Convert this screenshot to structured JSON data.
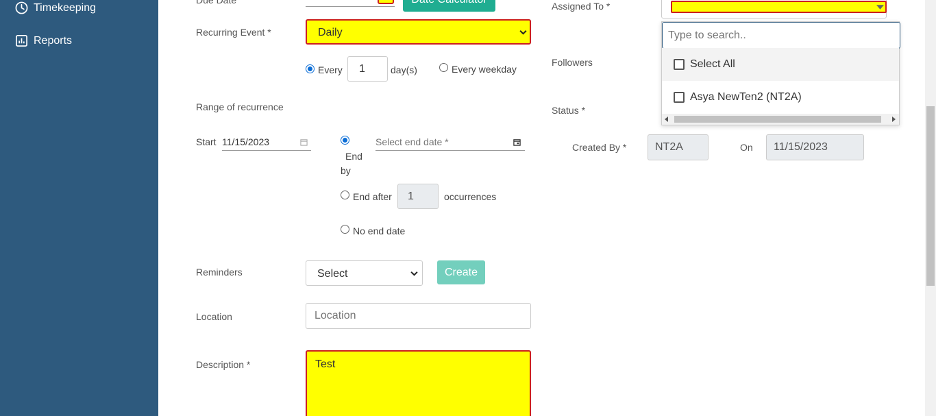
{
  "sidebar": {
    "items": [
      {
        "label": "Timekeeping",
        "icon": "clock-icon"
      },
      {
        "label": "Reports",
        "icon": "chart-icon"
      }
    ]
  },
  "form": {
    "due_date_label": "Due Date",
    "date_calculator_button": "Date Calculator",
    "recurring_event_label": "Recurring Event *",
    "recurring_event_value": "Daily",
    "every_label": "Every",
    "every_value": "1",
    "days_label": "day(s)",
    "every_weekday_label": "Every weekday",
    "range_label": "Range of recurrence",
    "start_label": "Start",
    "start_value": "11/15/2023",
    "end_date_placeholder": "Select end date *",
    "end_by_label": "End",
    "end_by_label2": "by",
    "end_after_label": "End after",
    "end_after_value": "1",
    "occurrences_label": "occurrences",
    "no_end_date_label": "No end date",
    "reminders_label": "Reminders",
    "reminders_value": "Select",
    "create_button": "Create",
    "location_label": "Location",
    "location_placeholder": "Location",
    "description_label": "Description *",
    "description_value": "Test"
  },
  "right": {
    "assigned_to_label": "Assigned To *",
    "followers_label": "Followers",
    "status_label": "Status *",
    "created_by_label": "Created By *",
    "created_by_value": "NT2A",
    "on_label": "On",
    "on_value": "11/15/2023"
  },
  "dropdown": {
    "search_placeholder": "Type to search..",
    "items": [
      {
        "label": "Select All",
        "checked": false
      },
      {
        "label": "Asya NewTen2 (NT2A)",
        "checked": false
      }
    ]
  },
  "colors": {
    "sidebar": "#2e5a7e",
    "required_highlight": "#ffff00",
    "required_border": "#cc2020",
    "teal": "#1fad91"
  }
}
